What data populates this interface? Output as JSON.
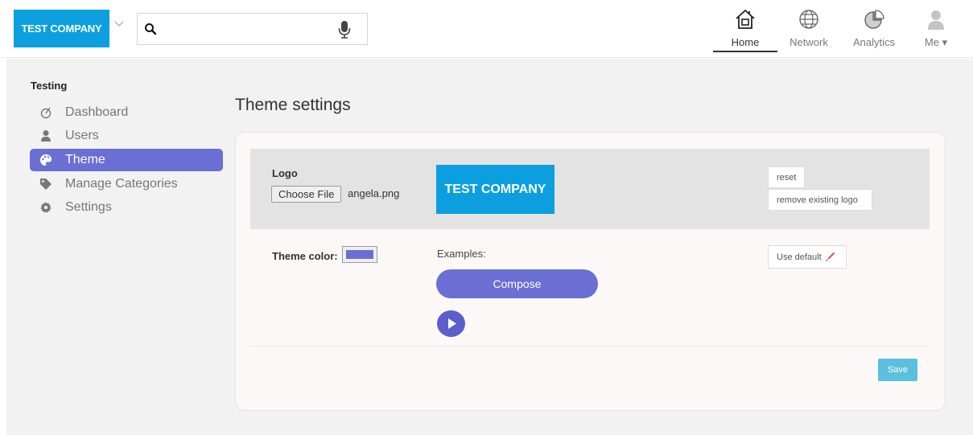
{
  "brand": {
    "name": "TEST COMPANY",
    "color": "#0b9fe0"
  },
  "search": {
    "placeholder": "",
    "value": ""
  },
  "nav": [
    {
      "label": "Home",
      "icon": "home-icon",
      "active": true
    },
    {
      "label": "Network",
      "icon": "globe-icon"
    },
    {
      "label": "Analytics",
      "icon": "pie-chart-icon"
    },
    {
      "label": "Me",
      "icon": "user-icon",
      "has_dropdown": true
    }
  ],
  "sidebar": {
    "title": "Testing",
    "items": [
      {
        "label": "Dashboard",
        "icon": "dashboard-icon"
      },
      {
        "label": "Users",
        "icon": "user-icon"
      },
      {
        "label": "Theme",
        "icon": "palette-icon",
        "active": true
      },
      {
        "label": "Manage Categories",
        "icon": "tag-icon"
      },
      {
        "label": "Settings",
        "icon": "gear-icon"
      }
    ]
  },
  "page": {
    "title": "Theme settings",
    "logo": {
      "label": "Logo",
      "choose_file": "Choose File",
      "file_name": "angela.png",
      "preview_text": "TEST COMPANY",
      "reset": "reset",
      "remove": "remove existing logo"
    },
    "theme": {
      "label": "Theme color:",
      "color": "#6b6fd3",
      "examples_label": "Examples:",
      "compose": "Compose",
      "use_default": "Use default"
    },
    "save": "Save"
  },
  "colors": {
    "accent": "#6b6fd3",
    "save": "#5bc0de"
  }
}
